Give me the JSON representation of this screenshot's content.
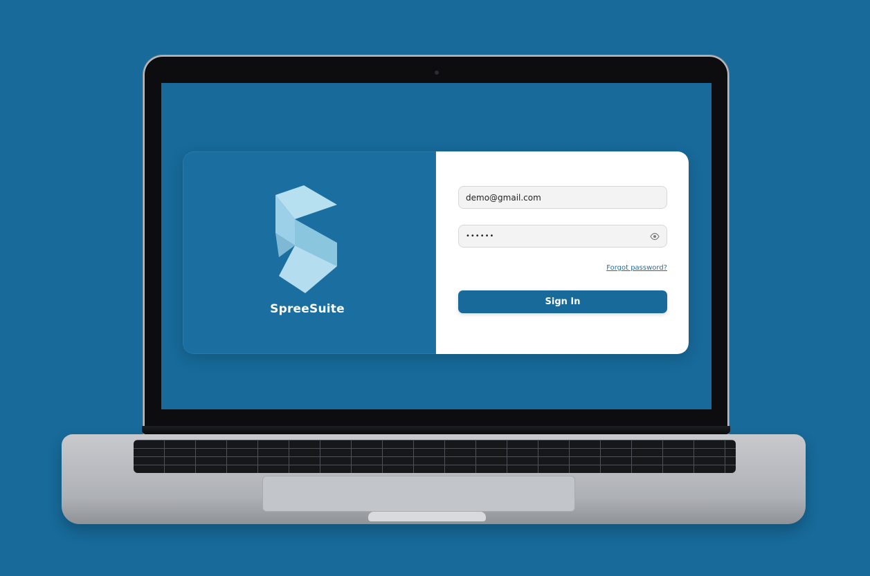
{
  "app": {
    "brand_name": "SpreeSuite",
    "logo_icon": "s-logo-icon"
  },
  "login": {
    "email_value": "demo@gmail.com",
    "password_value": "••••••",
    "password_icon": "eye-icon",
    "forgot_password_label": "Forgot password?",
    "sign_in_label": "Sign In"
  },
  "colors": {
    "background": "#176a9a",
    "button": "#176a9a",
    "link": "#1f6ea1",
    "logo_light": "#a9d6ea",
    "logo_mid": "#8cc4de"
  }
}
